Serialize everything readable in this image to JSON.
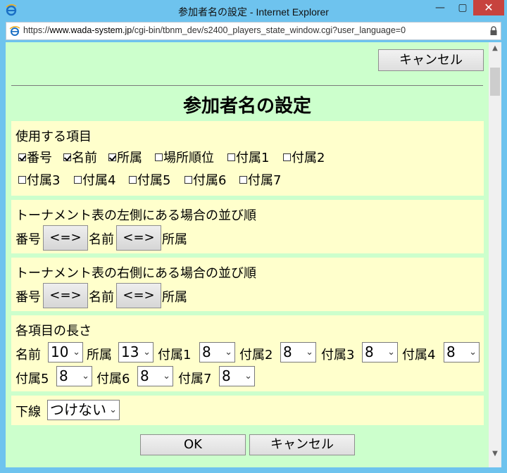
{
  "window": {
    "title": "参加者名の設定 - Internet Explorer",
    "minimize": "—",
    "maximize": "▢",
    "close": "✕"
  },
  "address": {
    "url_prefix": "https://",
    "url_host": "www.wada-system.jp",
    "url_path": "/cgi-bin/tbnm_dev/s2400_players_state_window.cgi?user_language=0"
  },
  "top_cancel": "キャンセル",
  "heading": "参加者名の設定",
  "items_section": {
    "title": "使用する項目",
    "checkboxes": [
      {
        "label": "番号",
        "checked": true
      },
      {
        "label": "名前",
        "checked": true
      },
      {
        "label": "所属",
        "checked": true
      },
      {
        "label": "場所順位",
        "checked": false
      },
      {
        "label": "付属1",
        "checked": false
      },
      {
        "label": "付属2",
        "checked": false
      },
      {
        "label": "付属3",
        "checked": false
      },
      {
        "label": "付属4",
        "checked": false
      },
      {
        "label": "付属5",
        "checked": false
      },
      {
        "label": "付属6",
        "checked": false
      },
      {
        "label": "付属7",
        "checked": false
      }
    ]
  },
  "left_order": {
    "title": "トーナメント表の左側にある場合の並び順",
    "items": [
      "番号",
      "名前",
      "所属"
    ],
    "swap_label": "<=>"
  },
  "right_order": {
    "title": "トーナメント表の右側にある場合の並び順",
    "items": [
      "番号",
      "名前",
      "所属"
    ],
    "swap_label": "<=>"
  },
  "lengths": {
    "title": "各項目の長さ",
    "fields": [
      {
        "label": "名前",
        "value": "10"
      },
      {
        "label": "所属",
        "value": "13"
      },
      {
        "label": "付属1",
        "value": "8"
      },
      {
        "label": "付属2",
        "value": "8"
      },
      {
        "label": "付属3",
        "value": "8"
      },
      {
        "label": "付属4",
        "value": "8"
      },
      {
        "label": "付属5",
        "value": "8"
      },
      {
        "label": "付属6",
        "value": "8"
      },
      {
        "label": "付属7",
        "value": "8"
      }
    ]
  },
  "underline": {
    "label": "下線",
    "value": "つけない"
  },
  "ok": "OK",
  "bottom_cancel": "キャンセル",
  "icons": {
    "chevron": "⌄"
  },
  "colors": {
    "content_bg": "#ccffcc",
    "panel_bg": "#ffffcc",
    "frame": "#6ec3ee"
  }
}
